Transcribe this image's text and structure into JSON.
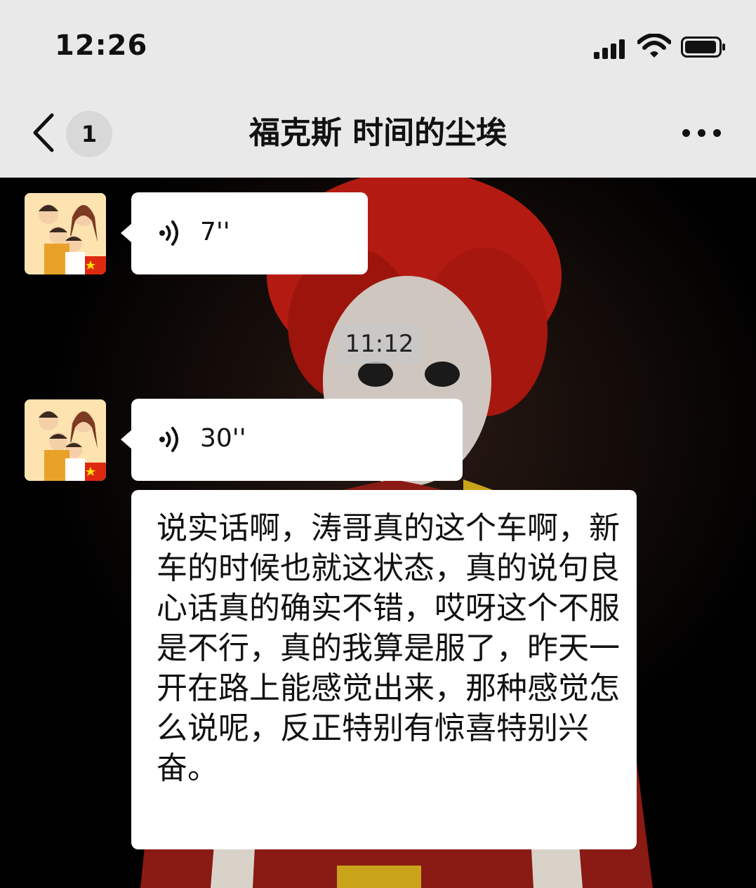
{
  "status_bar": {
    "time": "12:26"
  },
  "nav": {
    "unread_count": "1",
    "title": "福克斯 时间的尘埃"
  },
  "messages": [
    {
      "type": "voice",
      "duration": "7''"
    },
    {
      "type": "timestamp",
      "text": "11:12"
    },
    {
      "type": "voice",
      "duration": "30''"
    },
    {
      "type": "text",
      "text": "说实话啊，涛哥真的这个车啊，新车的时候也就这状态，真的说句良心话真的确实不错，哎呀这个不服是不行，真的我算是服了，昨天一开在路上能感觉出来，那种感觉怎么说呢，反正特别有惊喜特别兴奋。"
    }
  ],
  "icons": [
    "signal-icon",
    "wifi-icon",
    "battery-icon",
    "back-icon",
    "more-icon",
    "voice-icon"
  ],
  "colors": {
    "bar_bg": "#e9e9e9",
    "bubble_bg": "#ffffff",
    "chat_bg": "#000000"
  }
}
